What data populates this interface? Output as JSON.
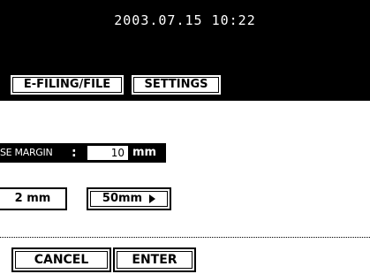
{
  "header": {
    "datetime": "2003.07.15 10:22",
    "tabs": [
      {
        "label": "E-FILING/FILE"
      },
      {
        "label": "SETTINGS"
      }
    ]
  },
  "margin": {
    "label": "SE MARGIN",
    "separator": ":",
    "value": "10",
    "unit": "mm"
  },
  "range": {
    "min_label": "2 mm",
    "max_label": "50mm"
  },
  "actions": {
    "cancel_label": "CANCEL",
    "enter_label": "ENTER"
  },
  "icons": {
    "max_arrow": "play-arrow-right-icon"
  },
  "colors": {
    "header_bg": "#000000",
    "text_on_dark": "#ffffff",
    "button_bg": "#ffffff"
  }
}
